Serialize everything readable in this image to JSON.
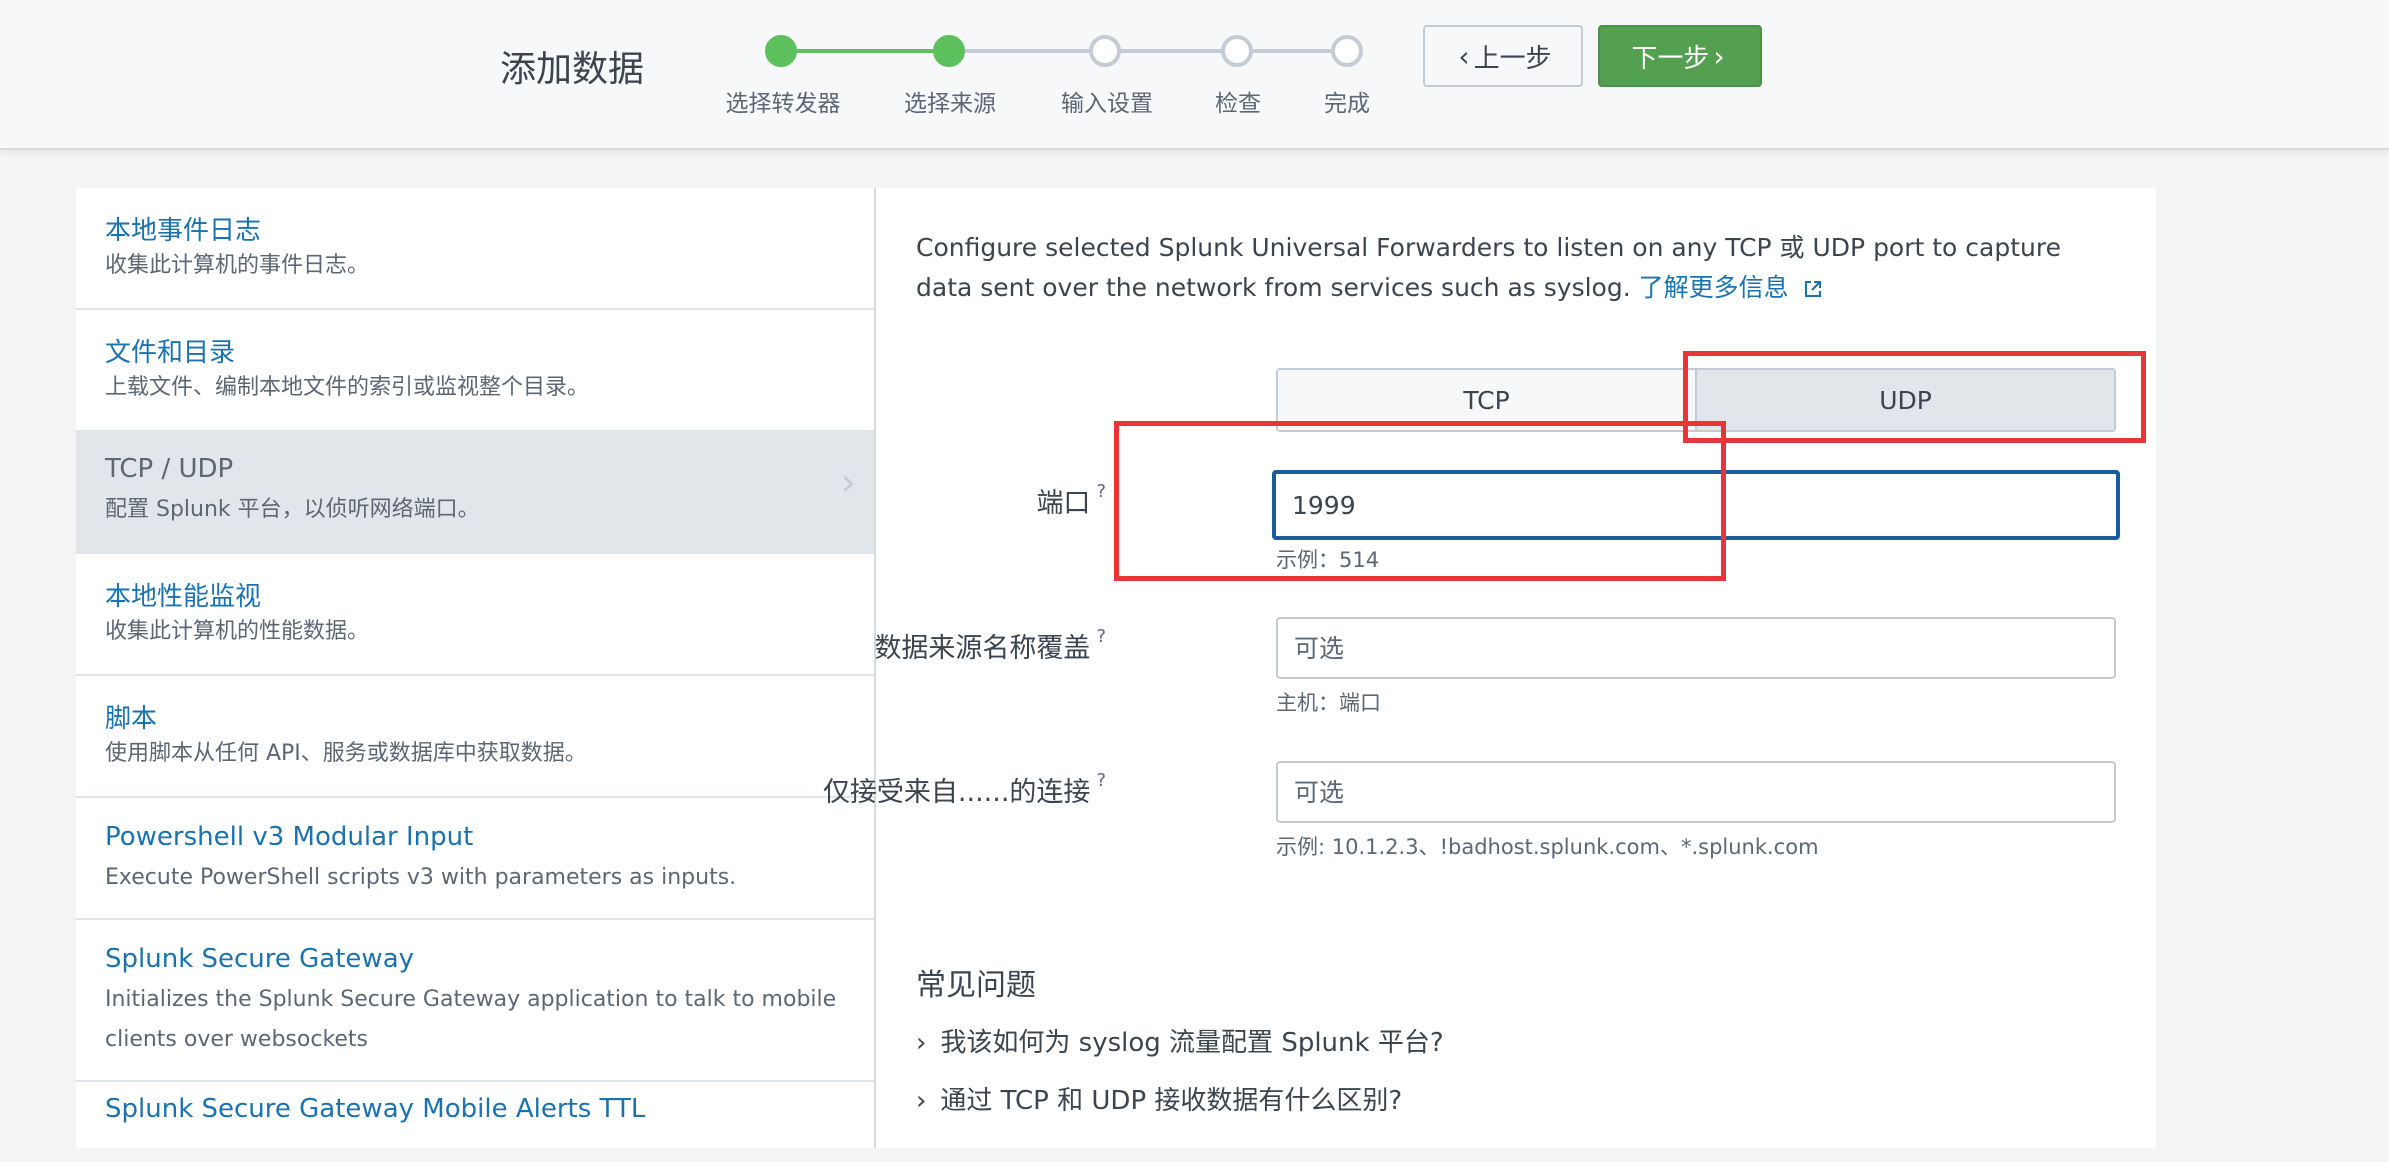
{
  "header": {
    "title": "添加数据",
    "steps": [
      {
        "label": "选择转发器",
        "state": "done"
      },
      {
        "label": "选择来源",
        "state": "done"
      },
      {
        "label": "输入设置",
        "state": "pending"
      },
      {
        "label": "检查",
        "state": "pending"
      },
      {
        "label": "完成",
        "state": "pending"
      }
    ],
    "back_label": "上一步",
    "next_label": "下一步"
  },
  "sources": [
    {
      "title": "本地事件日志",
      "desc": "收集此计算机的事件日志。"
    },
    {
      "title": "文件和目录",
      "desc": "上载文件、编制本地文件的索引或监视整个目录。"
    },
    {
      "title": "TCP / UDP",
      "desc": "配置 Splunk 平台，以侦听网络端口。",
      "selected": true
    },
    {
      "title": "本地性能监视",
      "desc": "收集此计算机的性能数据。"
    },
    {
      "title": "脚本",
      "desc": "使用脚本从任何 API、服务或数据库中获取数据。"
    },
    {
      "title": "Powershell v3 Modular Input",
      "desc": "Execute PowerShell scripts v3 with parameters as inputs."
    },
    {
      "title": "Splunk Secure Gateway",
      "desc": "Initializes the Splunk Secure Gateway application to talk to mobile clients over websockets"
    },
    {
      "title": "Splunk Secure Gateway Mobile Alerts TTL",
      "desc": ""
    }
  ],
  "main": {
    "intro_text": "Configure selected Splunk Universal Forwarders to listen on any TCP 或 UDP port to capture data sent over the network from services such as syslog.",
    "learn_more": "了解更多信息",
    "protocol": {
      "tcp": "TCP",
      "udp": "UDP",
      "selected": "UDP"
    },
    "fields": {
      "port": {
        "label": "端口",
        "qmark": "?",
        "value": "1999",
        "help": "示例：514"
      },
      "source_override": {
        "label": "数据来源名称覆盖",
        "qmark": "?",
        "placeholder": "可选",
        "help": "主机：端口"
      },
      "accept_from": {
        "label": "仅接受来自......的连接",
        "qmark": "?",
        "placeholder": "可选",
        "help": "示例: 10.1.2.3、!badhost.splunk.com、*.splunk.com"
      }
    },
    "faq": {
      "title": "常见问题",
      "items": [
        "我该如何为 syslog 流量配置 Splunk 平台?",
        "通过 TCP 和 UDP 接收数据有什么区别?"
      ]
    }
  },
  "colors": {
    "accent_green": "#53a051",
    "link_blue": "#1a73b0",
    "focus_blue": "#1a5c9e",
    "annotation_red": "#e8353a"
  }
}
